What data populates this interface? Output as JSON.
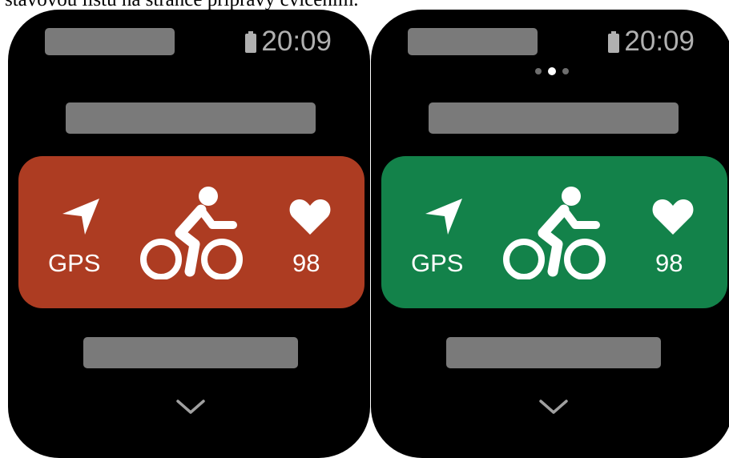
{
  "caption": "stavovou lištu na stránce přípravy cvičením.",
  "colors": {
    "card_red": "#ad3c22",
    "card_green": "#13824a",
    "placeholder_gray": "#7a7a7a",
    "status_gray": "#b0b0b0"
  },
  "watches": [
    {
      "time": "20:09",
      "gps_label": "GPS",
      "heart_rate": "98",
      "card_state": "red",
      "page_dots": false
    },
    {
      "time": "20:09",
      "gps_label": "GPS",
      "heart_rate": "98",
      "card_state": "green",
      "page_dots": true,
      "page_dots_count": 3,
      "page_dots_active": 2
    }
  ],
  "icons": [
    "battery-icon",
    "gps-arrow-icon",
    "cycling-icon",
    "heart-icon",
    "chevron-down-icon"
  ]
}
